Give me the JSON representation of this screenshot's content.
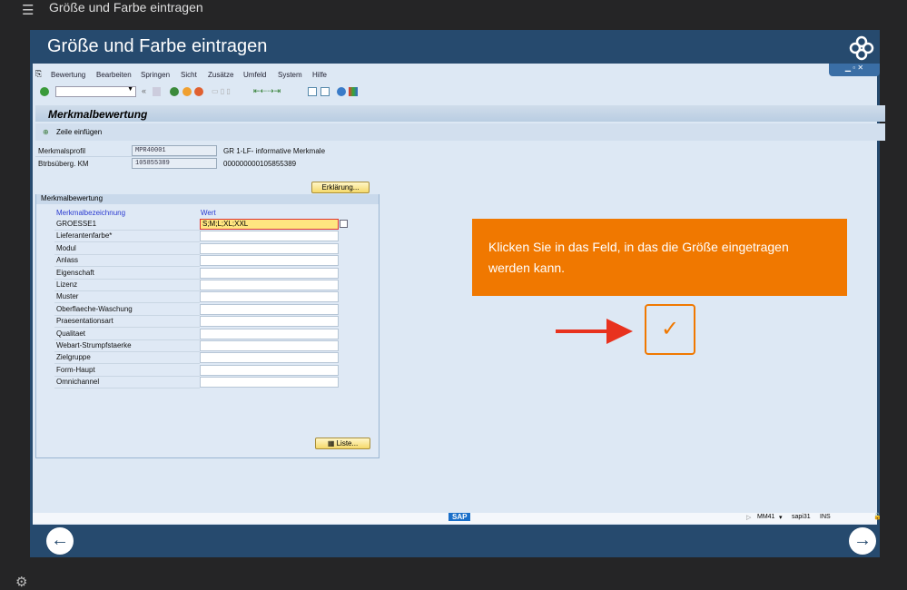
{
  "app": {
    "title": "Größe und Farbe eintragen"
  },
  "panel": {
    "title": "Größe und Farbe eintragen"
  },
  "menu": [
    "Bewertung",
    "Bearbeiten",
    "Springen",
    "Sicht",
    "Zusätze",
    "Umfeld",
    "System",
    "Hilfe"
  ],
  "sap": {
    "screen_title": "Merkmalbewertung",
    "app_button": "Zeile einfügen",
    "fields": [
      {
        "label": "Merkmalsprofil",
        "value": "MPR40001",
        "desc": "GR 1-LF- informative  Merkmale"
      },
      {
        "label": "Btrbsüberg. KM",
        "value": "105855389",
        "desc": "000000000105855389"
      }
    ],
    "explain_button": "Erklärung...",
    "group_title": "Merkmalbewertung",
    "col_name": "Merkmalbezeichnung",
    "col_value": "Wert",
    "rows": [
      {
        "name": "GROESSE1",
        "value": "S;M;L;XL;XXL"
      },
      {
        "name": "Lieferantenfarbe*",
        "value": ""
      },
      {
        "name": "Modul",
        "value": ""
      },
      {
        "name": "Anlass",
        "value": ""
      },
      {
        "name": "Eigenschaft",
        "value": ""
      },
      {
        "name": "Lizenz",
        "value": ""
      },
      {
        "name": "Muster",
        "value": ""
      },
      {
        "name": "Oberflaeche-Waschung",
        "value": ""
      },
      {
        "name": "Praesentationsart",
        "value": ""
      },
      {
        "name": "Qualitaet",
        "value": ""
      },
      {
        "name": "Webart-Strumpfstaerke",
        "value": ""
      },
      {
        "name": "Zielgruppe",
        "value": ""
      },
      {
        "name": "Form-Haupt",
        "value": ""
      },
      {
        "name": "Omnichannel",
        "value": ""
      }
    ],
    "list_button": "Liste...",
    "status": {
      "logo": "SAP",
      "transaction": "MM41",
      "server": "sapi31",
      "mode": "INS"
    }
  },
  "instruction": "Klicken Sie in das Feld, in das die Größe eingetragen werden kann.",
  "colors": {
    "accent": "#f07800",
    "panel": "#264a6e",
    "arrow": "#e8321e"
  }
}
